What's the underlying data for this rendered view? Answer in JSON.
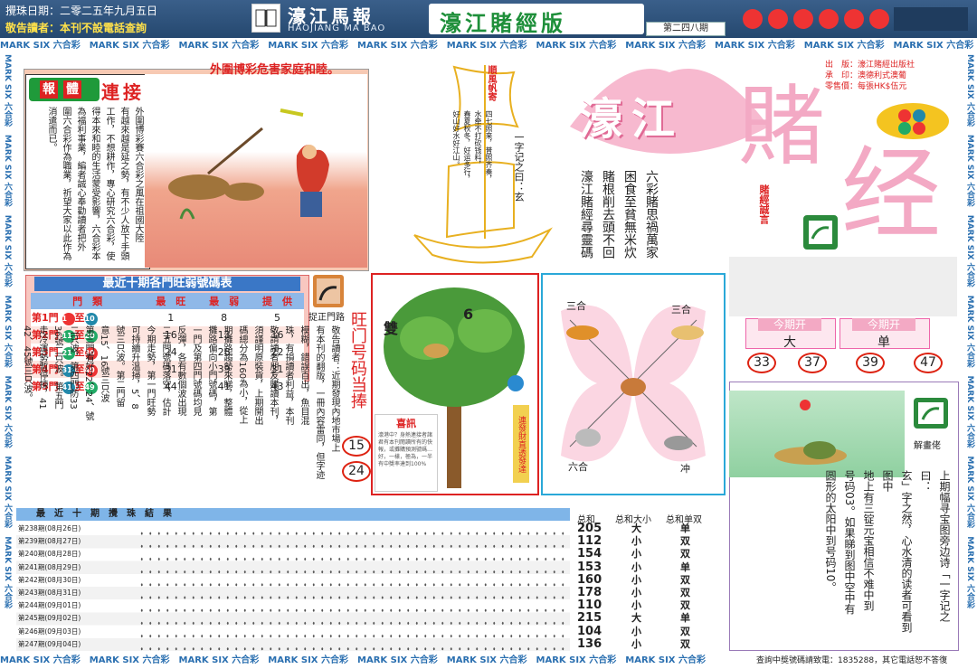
{
  "header": {
    "date": "攪珠日期：二零二五年九月五日",
    "warning": "敬告讀者：本刊不設電話查詢",
    "paper_name": "濠江馬報",
    "paper_pinyin": "HAOJIANG MA BAO",
    "edition": "濠江賭經版",
    "issue": "第二四八期"
  },
  "border": {
    "text": "MARK SIX 六合彩"
  },
  "publisher": {
    "publisher": "出　版：濠江賭經出版社",
    "printer": "承　印：澳德利式澳葡",
    "price": "零售價：每張HK$伍元"
  },
  "main_title": {
    "part1": "濠江",
    "part2": "賭",
    "part3": "经",
    "motto_label": "賭經誠言"
  },
  "motto": {
    "col1": "六彩賭思禍萬家",
    "col2": "困食至貧無米炊",
    "col3": "賭根削去頭不回",
    "col4": "濠江賭經尋靈碼"
  },
  "poem": {
    "sail_label": "順風帆寄",
    "col1": "一字记之曰：玄",
    "col2": "四七照来，普照齐奏，",
    "col3": "水牵不打砍钱料，",
    "col4": "春夏秋冬，好运多行，",
    "col5": "好山好水好江山。"
  },
  "report": {
    "headline": "外圍博彩危害家庭和睦。",
    "label1": "報",
    "label2": "體",
    "label3": "連",
    "label4": "接",
    "col1": "外圍博彩賽六合彩之風在祖國大陸",
    "col2": "有越來越是延之勢，有不少人放下手頭",
    "col3": "工作，不想耕作，專心研究六合彩，使",
    "col4": "得本來和睦的生活蒙受影響，六合彩本",
    "col5": "為福利事業，編者誠心奉勸讀者把外",
    "col6": "圍六合彩作為職業，祈望大家以此作為",
    "col7": "消遣而已。"
  },
  "stats_table": {
    "title": "最近十期各門旺弱號碼表",
    "headers": [
      "門　類",
      "最　旺",
      "最　弱",
      "提　供"
    ],
    "rows": [
      {
        "label": "第1門",
        "from": "1",
        "to": "10",
        "hot": "1",
        "cold": "8",
        "offer": "5"
      },
      {
        "label": "第2門",
        "from": "11",
        "to": "20",
        "hot": "16",
        "cold": "13",
        "offer": "16"
      },
      {
        "label": "第3門",
        "from": "21",
        "to": "30",
        "hot": "24",
        "cold": "28",
        "offer": "22"
      },
      {
        "label": "第4門",
        "from": "31",
        "to": "40",
        "hot": "31",
        "cold": "39",
        "offer": "31"
      },
      {
        "label": "第5門",
        "from": "41",
        "to": "49",
        "hot": "44",
        "cold": "41",
        "offer": "43"
      }
    ],
    "joiner": "至",
    "badge": "捉正門路"
  },
  "wangmen": {
    "title": "旺门号码当捧",
    "n1": "15",
    "n2": "24"
  },
  "tree": {
    "label": "雙",
    "number": "6",
    "news_title": "喜訊",
    "news_body": "濠港中？身熱連接者諸君有本刊閱讀所有的快報，或攤購預測號碼…好，一樣，極為，一半有中獎率達到100%",
    "banner": "連發財直透發達"
  },
  "zodiac": {
    "tl": "三合",
    "tr": "三合",
    "bl": "六合",
    "br": "冲"
  },
  "notice": {
    "col1": "敬告讀者：近期發現內地市場上",
    "col2": "有本刊的翻版，一冊內容雷同，但字迹",
    "col3": "模糊，錯誤百出，魚目混",
    "col4": "珠，有損讀者利益，本刊",
    "col5": "敬請讀者朋友購讀本刊，",
    "col6": "須謹明原裝貨，上期開出",
    "col7": "碼總分為160為小，從上",
    "col8": "期攤路趨勢來睇，整體",
    "col9": "攤路偏向小門號碼，第",
    "col10": "一門及第四門號碼均見",
    "col11": "反彈，各有數個波出現",
    "col12": "二五門號碼落空，估計",
    "col13": "今期走勢，第一門旺勢",
    "col14": "可持續升溫掃，5、8",
    "col15": "號三只波。第二門留",
    "col16": "意15、16號三只波",
    "col17": "第三門看好22、24、號",
    "col18": "二只波，第四門防33",
    "col19": "36號二只波。第五門",
    "col20": "走冷運勢暫停揀，41",
    "col21": "42、45號三只波。"
  },
  "today": {
    "label": "今期开",
    "v1": "大",
    "v2": "单",
    "nums": [
      "33",
      "37",
      "39",
      "47"
    ]
  },
  "explain": {
    "badge": "解畫佬",
    "col1": "上期幅寻宝图旁边诗「一字记之曰：",
    "col2": "玄」字之然，心水清的读者可看到图中",
    "col3": "地上有三锭元宝相信不难中到",
    "col4": "号码03。如果睇到图中空中有",
    "col5": "圆形的太阳中到号码10。"
  },
  "results": {
    "title": "最　近　十　期　攪　珠　結　果",
    "periods": [
      "第238期",
      "第239期",
      "第240期",
      "第241期",
      "第242期",
      "第243期",
      "第244期",
      "第245期",
      "第246期",
      "第247期"
    ],
    "dates": [
      "(08月26日)",
      "(08月27日)",
      "(08月28日)",
      "(08月29日)",
      "(08月30日)",
      "(08月31日)",
      "(09月01日)",
      "(09月02日)",
      "(09月03日)",
      "(09月04日)"
    ],
    "h_sum": "总和",
    "h_size": "总和大小",
    "h_oe": "总和单双",
    "sums": [
      "205",
      "112",
      "154",
      "153",
      "160",
      "178",
      "110",
      "215",
      "104",
      "136"
    ],
    "sizes": [
      "大",
      "小",
      "小",
      "小",
      "小",
      "小",
      "小",
      "大",
      "小",
      "小"
    ],
    "oes": [
      "单",
      "双",
      "双",
      "单",
      "双",
      "双",
      "双",
      "单",
      "双",
      "双"
    ]
  },
  "footer": {
    "text": "查詢中獎號碼請致電：1835288，其它電話恕不答復"
  }
}
